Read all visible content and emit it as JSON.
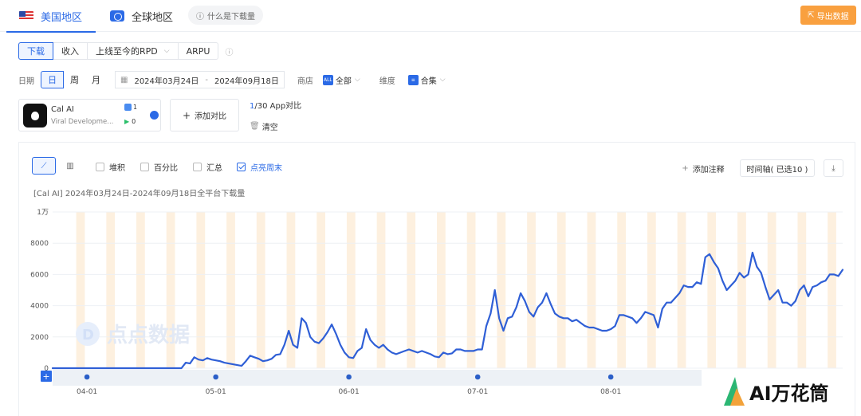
{
  "header": {
    "tabs": [
      {
        "label": "美国地区",
        "active": true
      },
      {
        "label": "全球地区",
        "active": false
      }
    ],
    "what_is_downloads": "什么是下载量",
    "export_label": "导出数据"
  },
  "metric_tabs": [
    {
      "label": "下载",
      "selected": true
    },
    {
      "label": "收入",
      "selected": false
    },
    {
      "label": "上线至今的RPD",
      "selected": false
    },
    {
      "label": "ARPU",
      "selected": false
    }
  ],
  "filters": {
    "date_label": "日期",
    "granularity": [
      {
        "label": "日",
        "selected": true
      },
      {
        "label": "周",
        "selected": false
      },
      {
        "label": "月",
        "selected": false
      }
    ],
    "date_start": "2024年03月24日",
    "date_sep": "-",
    "date_end": "2024年09月18日",
    "store_label": "商店",
    "store_value": "全部",
    "store_badge": "ALL",
    "dimension_label": "维度",
    "dimension_value": "合集"
  },
  "app": {
    "name": "Cal AI",
    "developer": "Viral Developme...",
    "ios_count": "1",
    "android_count": "0"
  },
  "compare": {
    "add_label": "添加对比",
    "count_current": "1",
    "count_text": "/30 App对比",
    "clear_label": "清空"
  },
  "chart_tools": {
    "stack": "堆积",
    "percent": "百分比",
    "summary": "汇总",
    "highlight_weekend": "点亮周末",
    "add_annotation": "添加注释",
    "timeline": "时间轴( 已选10 )"
  },
  "watermark": "点点数据",
  "brand_logo": "AI万花筒",
  "chart_data": {
    "type": "line",
    "title": "[Cal AI]  2024年03月24日-2024年09月18日全平台下载量",
    "y_tick_labels": [
      "0",
      "2000",
      "4000",
      "6000",
      "8000",
      "1万"
    ],
    "ylim": [
      0,
      10000
    ],
    "x_tick_labels": [
      "04-01",
      "05-01",
      "06-01",
      "07-01",
      "08-01"
    ],
    "start_date": "2024-03-24",
    "weekend_highlight": true,
    "line_color": "#2f5fd6",
    "series": [
      {
        "values": [
          0,
          0,
          0,
          0,
          0,
          0,
          0,
          0,
          0,
          0,
          0,
          0,
          0,
          0,
          0,
          0,
          0,
          0,
          0,
          0,
          0,
          0,
          0,
          0,
          0,
          0,
          0,
          0,
          0,
          0,
          0,
          350,
          300,
          700,
          550,
          500,
          650,
          550,
          500,
          450,
          350,
          300,
          250,
          200,
          150,
          450,
          800,
          700,
          600,
          450,
          500,
          600,
          850,
          900,
          1500,
          2400,
          1500,
          1300,
          3200,
          2900,
          2000,
          1700,
          1600,
          1900,
          2300,
          2800,
          2200,
          1500,
          1000,
          700,
          650,
          1100,
          1300,
          2500,
          1800,
          1500,
          1300,
          1500,
          1200,
          1000,
          900,
          1000,
          1100,
          1200,
          1100,
          1000,
          1100,
          1000,
          900,
          750,
          700,
          1000,
          900,
          950,
          1200,
          1200,
          1100,
          1100,
          1100,
          1200,
          1200,
          2700,
          3500,
          5000,
          3200,
          2400,
          3200,
          3300,
          3900,
          4800,
          4300,
          3600,
          3300,
          3900,
          4200,
          4800,
          4100,
          3500,
          3300,
          3200,
          3200,
          3000,
          3100,
          2900,
          2700,
          2600,
          2600,
          2500,
          2400,
          2400,
          2500,
          2700,
          3400,
          3400,
          3300,
          3200,
          2900,
          3200,
          3600,
          3500,
          3400,
          2600,
          3800,
          4200,
          4200,
          4500,
          4800,
          5300,
          5200,
          5200,
          5500,
          5400,
          7100,
          7300,
          6800,
          6400,
          5600,
          5000,
          5300,
          5600,
          6100,
          5800,
          6000,
          7400,
          6500,
          6100,
          5200,
          4400,
          4700,
          5000,
          4200,
          4200,
          4000,
          4300,
          5000,
          5300,
          4600,
          5200,
          5300,
          5500,
          5600,
          6000,
          6000,
          5900,
          6300
        ]
      }
    ]
  }
}
